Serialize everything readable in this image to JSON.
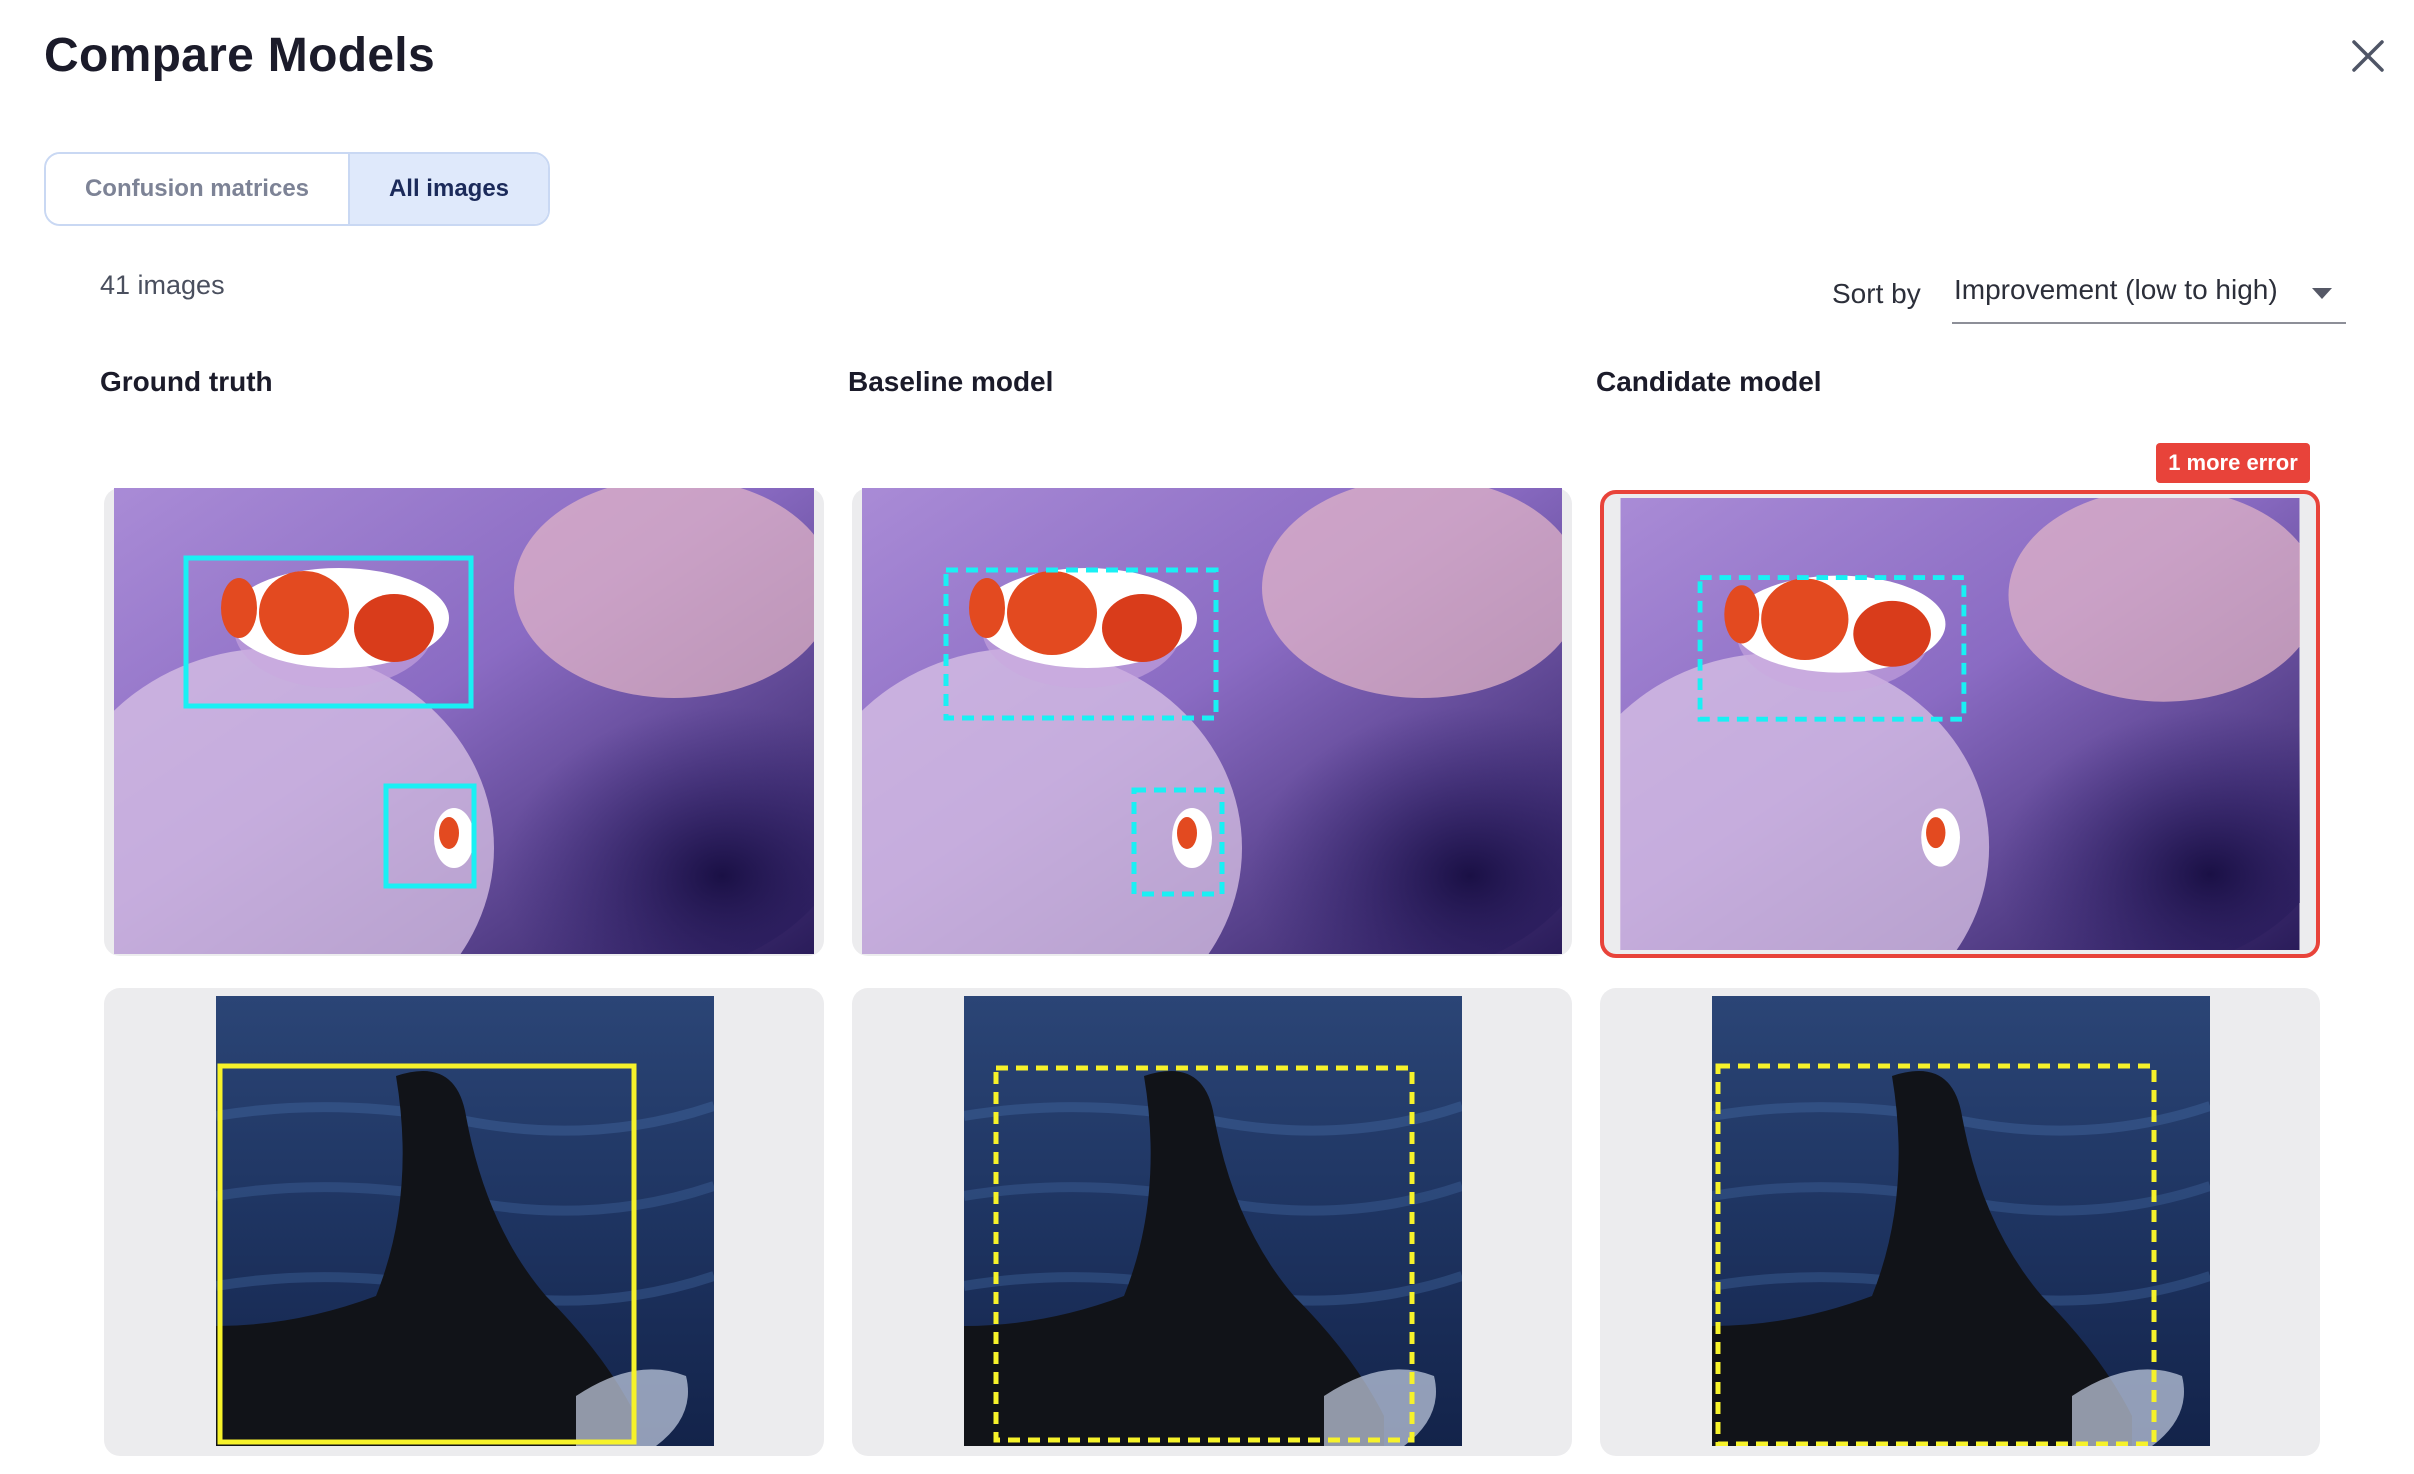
{
  "header": {
    "title": "Compare Models"
  },
  "tabs": [
    {
      "label": "Confusion matrices",
      "active": false
    },
    {
      "label": "All images",
      "active": true
    }
  ],
  "summary": {
    "count_label": "41 images"
  },
  "sort": {
    "label": "Sort by",
    "value": "Improvement (low to high)"
  },
  "columns": [
    {
      "heading": "Ground truth"
    },
    {
      "heading": "Baseline model"
    },
    {
      "heading": "Candidate model"
    }
  ],
  "badges": {
    "error_label": "1 more error"
  },
  "colors": {
    "accent_tab": "#dfe9fb",
    "error": "#e8433a",
    "clownfish_box": "#19f0f4",
    "fin_box": "#f6f22a"
  },
  "icons": {
    "close": "close-icon"
  }
}
